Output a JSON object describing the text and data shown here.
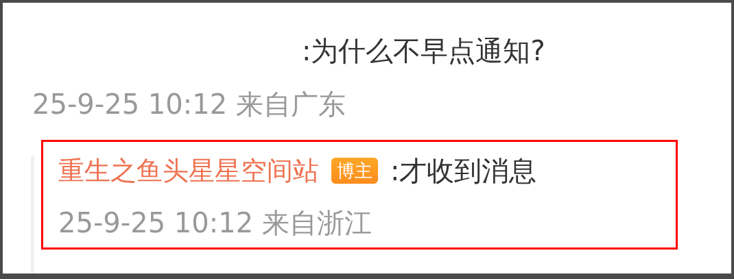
{
  "comment": {
    "text": ":为什么不早点通知?",
    "meta": "25-9-25 10:12 来自广东"
  },
  "reply": {
    "author": "重生之鱼头星星空间站",
    "badge": "博主",
    "text": ":才收到消息",
    "meta": "25-9-25 10:12 来自浙江",
    "highlighted": true
  }
}
